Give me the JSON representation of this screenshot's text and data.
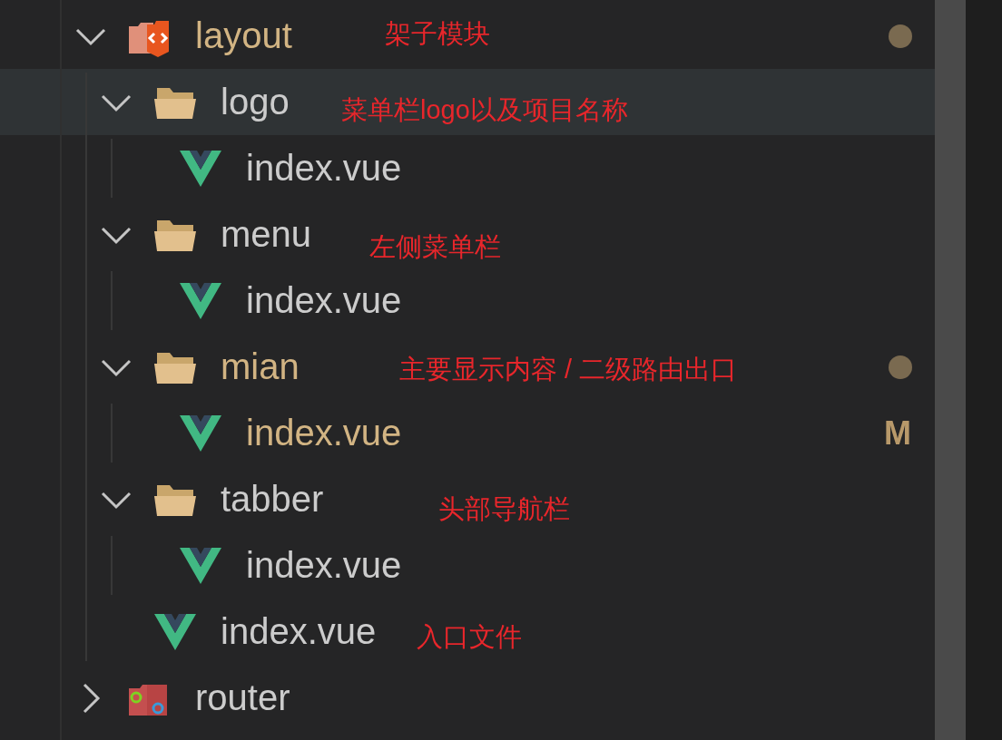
{
  "tree": [
    {
      "name": "layout",
      "kind": "layout",
      "expanded": true,
      "selected": false,
      "modified": true,
      "note": "架子模块",
      "children": [
        {
          "name": "logo",
          "kind": "folder",
          "expanded": true,
          "selected": true,
          "modified": false,
          "note": "菜单栏logo以及项目名称",
          "children": [
            {
              "name": "index.vue",
              "kind": "vue",
              "selected": false,
              "modified": false
            }
          ]
        },
        {
          "name": "menu",
          "kind": "folder",
          "expanded": true,
          "selected": false,
          "modified": false,
          "note": "左侧菜单栏",
          "children": [
            {
              "name": "index.vue",
              "kind": "vue",
              "selected": false,
              "modified": false
            }
          ]
        },
        {
          "name": "mian",
          "kind": "folder",
          "expanded": true,
          "selected": false,
          "modified": true,
          "note": "主要显示内容 / 二级路由出口",
          "children": [
            {
              "name": "index.vue",
              "kind": "vue",
              "selected": false,
              "modified": true,
              "badge": "M"
            }
          ]
        },
        {
          "name": "tabber",
          "kind": "folder",
          "expanded": true,
          "selected": false,
          "modified": false,
          "note": "头部导航栏",
          "children": [
            {
              "name": "index.vue",
              "kind": "vue",
              "selected": false,
              "modified": false
            }
          ]
        },
        {
          "name": "index.vue",
          "kind": "vue",
          "selected": false,
          "modified": false,
          "note": "入口文件"
        }
      ]
    },
    {
      "name": "router",
      "kind": "router",
      "expanded": false,
      "selected": false,
      "modified": false
    }
  ]
}
